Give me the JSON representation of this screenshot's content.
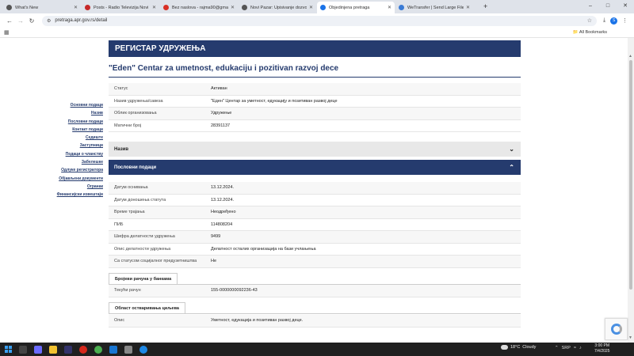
{
  "browser": {
    "tabs": [
      {
        "title": "What's New",
        "color": "#555555"
      },
      {
        "title": "Posts - Radio Televizija Novi Pazar",
        "color": "#c62828"
      },
      {
        "title": "Bez naslova - rajma90@gmail.com",
        "color": "#d93025"
      },
      {
        "title": "Novi Pazar: Upisivanje dozvolen...",
        "color": "#555555"
      },
      {
        "title": "Objedinjena pretraga",
        "color": "#1a73e8"
      },
      {
        "title": "WeTransfer | Send Large Files Fast",
        "color": "#3a7bd5"
      }
    ],
    "url": "pretraga.apr.gov.rs/detail",
    "all_bookmarks": "All Bookmarks",
    "profile_initial": "S"
  },
  "page": {
    "banner": "РЕГИСТАР УДРУЖЕЊА",
    "org_title": "\"Eden\" Centar za umetnost, edukaciju i pozitivan razvoj dece",
    "sidenav": [
      "Основни подаци",
      "Назив",
      "Пословни подаци",
      "Контакт подаци",
      "Седиште",
      "Заступници",
      "Подаци о чланству",
      "Забелешке",
      "Одлуке регистратора",
      "Објављени документи",
      "Огранак",
      "Финансијски извештаји"
    ],
    "basic": [
      {
        "k": "Статус",
        "v": "Активан"
      },
      {
        "k": "Назив удружења/савеза",
        "v": "\"Еден\" Центар за уметност, едукацију и позитиван развој деце"
      },
      {
        "k": "Облик организовања",
        "v": "Удружење"
      },
      {
        "k": "Матични број",
        "v": "28391137"
      }
    ],
    "section_name": "Назив",
    "section_business": "Пословни подаци",
    "business": [
      {
        "k": "Датум оснивања",
        "v": "13.12.2024."
      },
      {
        "k": "Датум доношења статута",
        "v": "13.12.2024."
      },
      {
        "k": "Време трајања",
        "v": "Неодређено"
      },
      {
        "k": "ПИБ",
        "v": "114808204"
      },
      {
        "k": "Шифра делатности удружења",
        "v": "9499"
      },
      {
        "k": "Опис делатности удружења",
        "v": "Делатност осталих организација на бази учлањења"
      },
      {
        "k": "Са статусом социјалног предузетништва",
        "v": "Не"
      }
    ],
    "accounts_tab": "Бројеви рачуна у банкама",
    "accounts": [
      {
        "k": "Текући рачун",
        "v": "155-0000000092236-43"
      }
    ],
    "goals_tab": "Област остваривања циљева",
    "goals": [
      {
        "k": "Опис",
        "v": "Уметност, едукација и позитиван развој деце."
      }
    ]
  },
  "taskbar": {
    "weather_temp": "18°C",
    "weather_text": "Cloudy",
    "lang": "SRP",
    "time": "3:00 PM",
    "date": "7/4/2025"
  },
  "colors": {
    "brand": "#253b6e"
  }
}
